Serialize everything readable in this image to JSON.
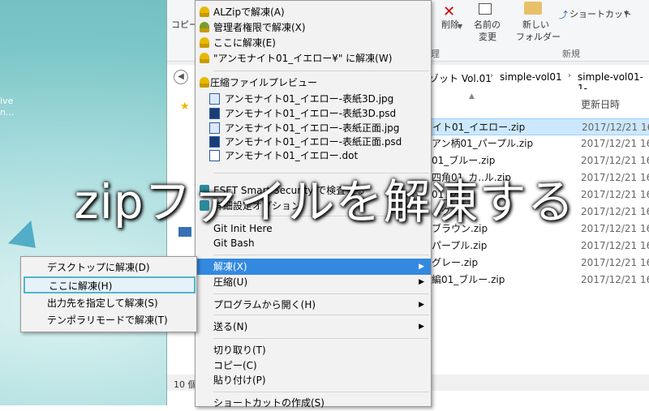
{
  "desktop": {
    "text1": "ive",
    "text2": "n..."
  },
  "ribbon": {
    "copy_label": "コピー",
    "delete_label": "削除",
    "rename_label1": "名前の",
    "rename_label2": "変更",
    "new_folder_label1": "新しい",
    "new_folder_label2": "フォルダー",
    "shortcut_label": "ショートカット",
    "group_organize": "理",
    "group_new": "新規"
  },
  "address": {
    "crumbs": [
      "ゾット Vol.01",
      "simple-vol01",
      "simple-vol01-1-"
    ]
  },
  "filelist": {
    "date_header": "更新日時",
    "rows": [
      {
        "name": "イト01_イエロー.zip",
        "date": "2017/12/21 16",
        "selected": true
      },
      {
        "name": "アン柄01_パープル.zip",
        "date": "2017/12/21 16",
        "selected": false
      },
      {
        "name": "01_ブルー.zip",
        "date": "2017/12/21 16",
        "selected": false
      },
      {
        "name": "四角01_カ..ル.zip",
        "date": "2017/12/21 16",
        "selected": false
      },
      {
        "name": "01_グ...",
        "date": "2017/12/21 16",
        "selected": false
      },
      {
        "name": "...ク.zip",
        "date": "2017/12/21 16",
        "selected": false
      },
      {
        "name": "ブラウン.zip",
        "date": "2017/12/21 16",
        "selected": false
      },
      {
        "name": "パープル.zip",
        "date": "2017/12/21 16",
        "selected": false
      },
      {
        "name": "グレー.zip",
        "date": "2017/12/21 16",
        "selected": false
      },
      {
        "name": "編01_ブルー.zip",
        "date": "2017/12/21 16",
        "selected": false
      }
    ]
  },
  "status": {
    "count": "10 個"
  },
  "menu": {
    "items_top": [
      {
        "label": "ALZipで解凍(A)",
        "icon": "lock-icon"
      },
      {
        "label": "管理者権限で解凍(X)",
        "icon": "admin-icon"
      },
      {
        "label": "ここに解凍(E)",
        "icon": "lock-icon"
      },
      {
        "label": "\"アンモナイト01_イエロー¥\" に解凍(W)",
        "icon": "lock-icon"
      }
    ],
    "preview_label": "圧縮ファイルプレビュー",
    "preview_files": [
      {
        "label": "アンモナイト01_イエロー-表紙3D.jpg",
        "type": "jpg"
      },
      {
        "label": "アンモナイト01_イエロー-表紙3D.psd",
        "type": "psd"
      },
      {
        "label": "アンモナイト01_イエロー-表紙正面.jpg",
        "type": "jpg"
      },
      {
        "label": "アンモナイト01_イエロー-表紙正面.psd",
        "type": "psd"
      },
      {
        "label": "アンモナイト01_イエロー.dot",
        "type": "dot"
      }
    ],
    "eset": "ESET Smart Security で検査する",
    "eset_opt": "詳細設定オプション",
    "git_init": "Git Init Here",
    "git_bash": "Git Bash",
    "extract": "解凍(X)",
    "compress": "圧縮(U)",
    "open_with": "プログラムから開く(H)",
    "send_to": "送る(N)",
    "cut": "切り取り(T)",
    "copy": "コピー(C)",
    "paste": "貼り付け(P)",
    "create_shortcut": "ショートカットの作成(S)"
  },
  "submenu": {
    "items": [
      "デスクトップに解凍(D)",
      "ここに解凍(H)",
      "出力先を指定して解凍(S)",
      "テンポラリモードで解凍(T)"
    ]
  },
  "overlay": {
    "title": "zipファイルを解凍する"
  }
}
